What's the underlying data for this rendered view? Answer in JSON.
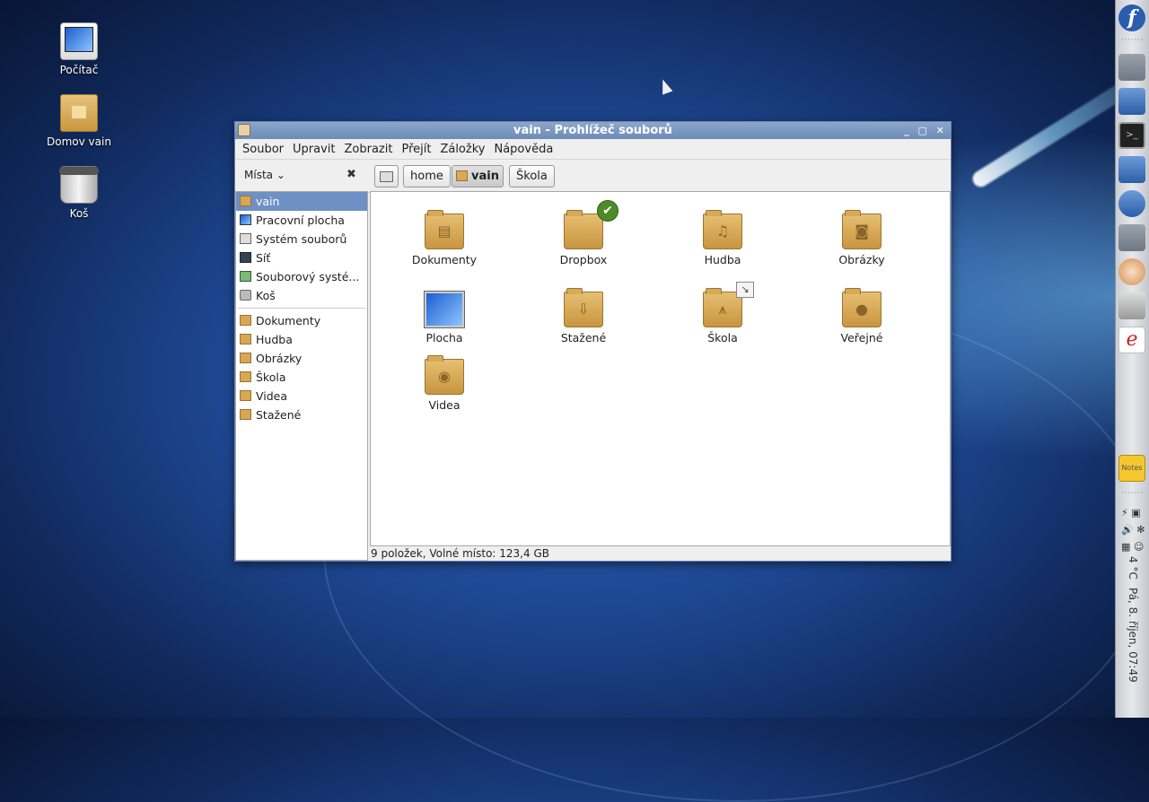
{
  "desktop": {
    "icons": [
      {
        "label": "Počítač"
      },
      {
        "label": "Domov vain"
      },
      {
        "label": "Koš"
      }
    ]
  },
  "window": {
    "title": "vain - Prohlížeč souborů",
    "controls": "_ ▢ ✕",
    "menu": [
      "Soubor",
      "Upravit",
      "Zobrazit",
      "Přejít",
      "Záložky",
      "Nápověda"
    ],
    "places_label": "Místa",
    "path": [
      "home",
      "vain",
      "Škola"
    ],
    "sidebar": {
      "places": [
        "vain",
        "Pracovní plocha",
        "Systém souborů",
        "Síť",
        "Souborový systé...",
        "Koš"
      ],
      "bookmarks": [
        "Dokumenty",
        "Hudba",
        "Obrázky",
        "Škola",
        "Videa",
        "Stažené"
      ]
    },
    "files": [
      {
        "name": "Dokumenty",
        "icon": "document-folder-icon"
      },
      {
        "name": "Dropbox",
        "icon": "dropbox-folder-icon"
      },
      {
        "name": "Hudba",
        "icon": "music-folder-icon"
      },
      {
        "name": "Obrázky",
        "icon": "pictures-folder-icon"
      },
      {
        "name": "Plocha",
        "icon": "desktop-folder-icon"
      },
      {
        "name": "Stažené",
        "icon": "downloads-folder-icon"
      },
      {
        "name": "Škola",
        "icon": "school-folder-icon"
      },
      {
        "name": "Veřejné",
        "icon": "public-folder-icon"
      },
      {
        "name": "Videa",
        "icon": "videos-folder-icon"
      }
    ],
    "status": "9 položek, Volné místo: 123,4 GB"
  },
  "panel": {
    "temperature": "4 °C",
    "clock": "Pá, 8. říjen, 07:49"
  }
}
